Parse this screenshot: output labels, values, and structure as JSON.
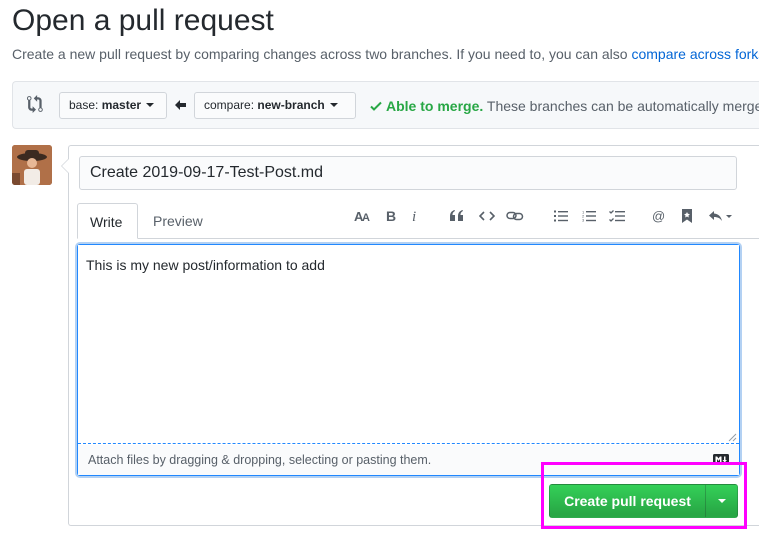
{
  "header": {
    "title": "Open a pull request",
    "subtitle_text": "Create a new pull request by comparing changes across two branches. If you need to, you can also ",
    "subtitle_link": "compare across forks."
  },
  "range": {
    "base_prefix": "base: ",
    "base_value": "master",
    "compare_prefix": "compare: ",
    "compare_value": "new-branch",
    "merge_status": "Able to merge.",
    "merge_detail": " These branches can be automatically merged."
  },
  "form": {
    "title_value": "Create 2019-09-17-Test-Post.md",
    "tabs": [
      {
        "label": "Write"
      },
      {
        "label": "Preview"
      }
    ],
    "toolbar_icons": [
      "header-icon",
      "bold-icon",
      "italic-icon",
      "quote-icon",
      "code-icon",
      "link-icon",
      "bulleted-list-icon",
      "numbered-list-icon",
      "task-list-icon",
      "mention-icon",
      "reference-icon",
      "reply-icon"
    ],
    "body_value": "This is my new post/information to add",
    "attach_text": "Attach files by dragging & dropping, selecting or pasting them."
  },
  "actions": {
    "create_label": "Create pull request",
    "success_color": "#28a745",
    "highlight_color": "#ff00ff"
  }
}
